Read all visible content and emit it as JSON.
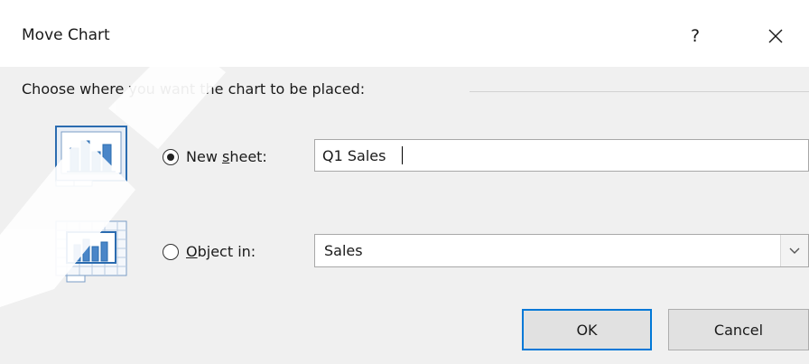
{
  "dialog": {
    "title": "Move Chart",
    "help_label": "?",
    "close_icon": "close-icon"
  },
  "group": {
    "label": "Choose where you want the chart to be placed:"
  },
  "new_sheet": {
    "icon": "new-sheet-chart-icon",
    "label_before": "New ",
    "label_accel": "s",
    "label_after": "heet:",
    "selected": true,
    "value": "Q1 Sales"
  },
  "object_in": {
    "icon": "object-in-chart-icon",
    "label_accel": "O",
    "label_after": "bject in:",
    "selected": false,
    "value": "Sales",
    "dropdown_icon": "chevron-down-icon"
  },
  "buttons": {
    "ok": "OK",
    "cancel": "Cancel"
  },
  "colors": {
    "accent": "#0078d7",
    "icon_blue": "#2b6cb0",
    "watermark": "#ffffff"
  }
}
